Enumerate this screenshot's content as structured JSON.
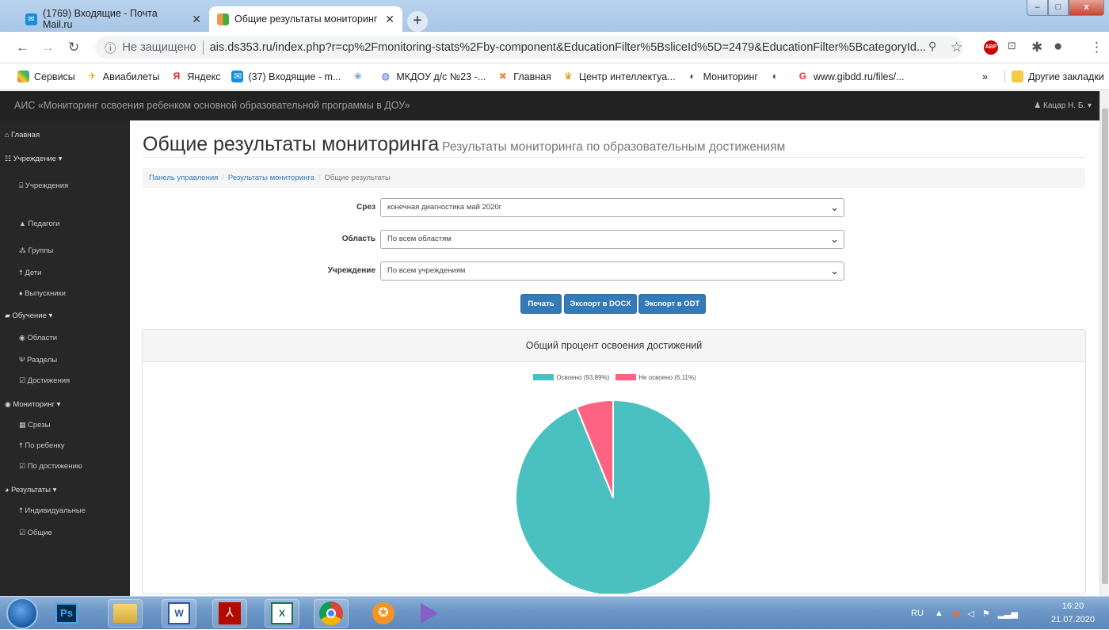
{
  "browser": {
    "tabs": [
      {
        "title": "(1769) Входящие - Почта Mail.ru",
        "close": "✕",
        "favicon": "mail-icon"
      },
      {
        "title": "Общие результаты мониторинг",
        "close": "✕",
        "favicon": "app-icon"
      }
    ],
    "new_tab": "+",
    "window_controls": {
      "minimize": "–",
      "maximize": "□",
      "close": "x"
    },
    "url_security": "Не защищено",
    "url": "ais.ds353.ru/index.php?r=cp%2Fmonitoring-stats%2Fby-component&EducationFilter%5BsliceId%5D=2479&EducationFilter%5BcategoryId...",
    "bookmarks": [
      "Сервисы",
      "Авиабилеты",
      "Яндекс",
      "(37) Входящие - m...",
      "",
      "МКДОУ д/с №23 -...",
      "Главная",
      "Центр интеллектуа...",
      "Мониторинг",
      "",
      "www.gibdd.ru/files/..."
    ],
    "bookmarks_more": "»",
    "other_bookmarks": "Другие закладки"
  },
  "app": {
    "title": "АИС «Мониторинг освоения ребенком основной образовательной программы в ДОУ»",
    "user": "Кацар Н. Б."
  },
  "sidebar": {
    "items": [
      {
        "label": "Главная",
        "icon": "home-icon",
        "glyph": "⌂",
        "sub": false
      },
      {
        "label": "Учреждение ▾",
        "icon": "users-icon",
        "glyph": "☷",
        "sub": false
      },
      {
        "label": "Учреждения",
        "icon": "bank-icon",
        "glyph": "⌸",
        "sub": true
      },
      {
        "label": "Педагоги",
        "icon": "graduation-icon",
        "glyph": "▲",
        "sub": true
      },
      {
        "label": "Группы",
        "icon": "sitemap-icon",
        "glyph": "⁂",
        "sub": true
      },
      {
        "label": "Дети",
        "icon": "child-icon",
        "glyph": "☨",
        "sub": true
      },
      {
        "label": "Выпускники",
        "icon": "graduate-icon",
        "glyph": "♦",
        "sub": true
      },
      {
        "label": "Обучение ▾",
        "icon": "book-icon",
        "glyph": "▰",
        "sub": false
      },
      {
        "label": "Области",
        "icon": "globe-icon",
        "glyph": "◉",
        "sub": true
      },
      {
        "label": "Разделы",
        "icon": "fork-icon",
        "glyph": "Ψ",
        "sub": true
      },
      {
        "label": "Достижения",
        "icon": "check-square-icon",
        "glyph": "☑",
        "sub": true
      },
      {
        "label": "Мониторинг ▾",
        "icon": "eye-icon",
        "glyph": "◉",
        "sub": false
      },
      {
        "label": "Срезы",
        "icon": "calendar-icon",
        "glyph": "▦",
        "sub": true
      },
      {
        "label": "По ребенку",
        "icon": "child-icon",
        "glyph": "☨",
        "sub": true
      },
      {
        "label": "По достижению",
        "icon": "check-square-icon",
        "glyph": "☑",
        "sub": true
      },
      {
        "label": "Результаты ▾",
        "icon": "pie-chart-icon",
        "glyph": "◕",
        "sub": false
      },
      {
        "label": "Индивидуальные",
        "icon": "child-icon",
        "glyph": "☨",
        "sub": true
      },
      {
        "label": "Общие",
        "icon": "check-square-icon",
        "glyph": "☑",
        "sub": true
      }
    ]
  },
  "page": {
    "title": "Общие результаты мониторинга",
    "subtitle": "Результаты мониторинга по образовательным достижениям",
    "breadcrumb": [
      "Панель управления",
      "Результаты мониторинга",
      "Общие результаты"
    ],
    "filters": [
      {
        "label": "Срез",
        "value": "конечная диагностика май 2020г"
      },
      {
        "label": "Область",
        "value": "По всем областям"
      },
      {
        "label": "Учреждение",
        "value": "По всем учреждениям"
      }
    ],
    "buttons": {
      "print": "Печать",
      "docx": "Экспорт в DOCX",
      "odt": "Экспорт в ODT"
    },
    "panel_title": "Общий процент освоения достижений"
  },
  "chart_data": {
    "type": "pie",
    "series": [
      {
        "name": "Освоено (93,89%)",
        "value": 93.89,
        "color": "#4bc0c0"
      },
      {
        "name": "Не освоено (6,11%)",
        "value": 6.11,
        "color": "#ff6384"
      }
    ]
  },
  "taskbar": {
    "lang": "RU",
    "time": "16:20",
    "date": "21.07.2020",
    "apps": [
      "Ps",
      "folder",
      "W",
      "pdf",
      "X",
      "chrome",
      "ok",
      "vs"
    ]
  }
}
